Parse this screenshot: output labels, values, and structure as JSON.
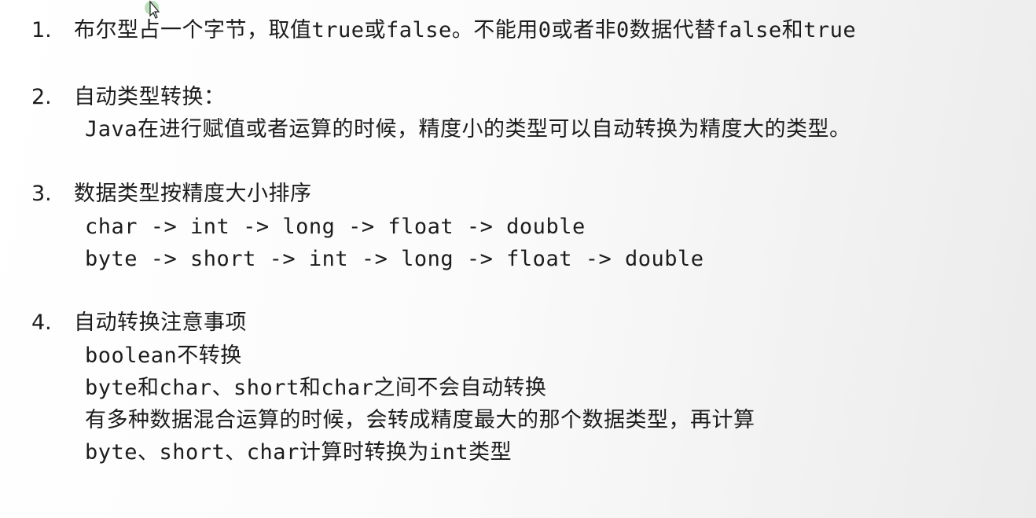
{
  "items": [
    {
      "number": "1.",
      "lines": [
        "布尔型占一个字节，取值true或false。不能用0或者非0数据代替false和true"
      ]
    },
    {
      "number": "2.",
      "lines": [
        "自动类型转换：",
        "Java在进行赋值或者运算的时候，精度小的类型可以自动转换为精度大的类型。"
      ]
    },
    {
      "number": "3.",
      "lines": [
        "数据类型按精度大小排序",
        "char -> int -> long -> float -> double",
        "byte -> short -> int -> long -> float -> double"
      ]
    },
    {
      "number": "4.",
      "lines": [
        "自动转换注意事项",
        "boolean不转换",
        "byte和char、short和char之间不会自动转换",
        "有多种数据混合运算的时候，会转成精度最大的那个数据类型，再计算",
        "byte、short、char计算时转换为int类型"
      ]
    }
  ],
  "icons": {
    "cursor": "pointer-cursor-icon"
  }
}
